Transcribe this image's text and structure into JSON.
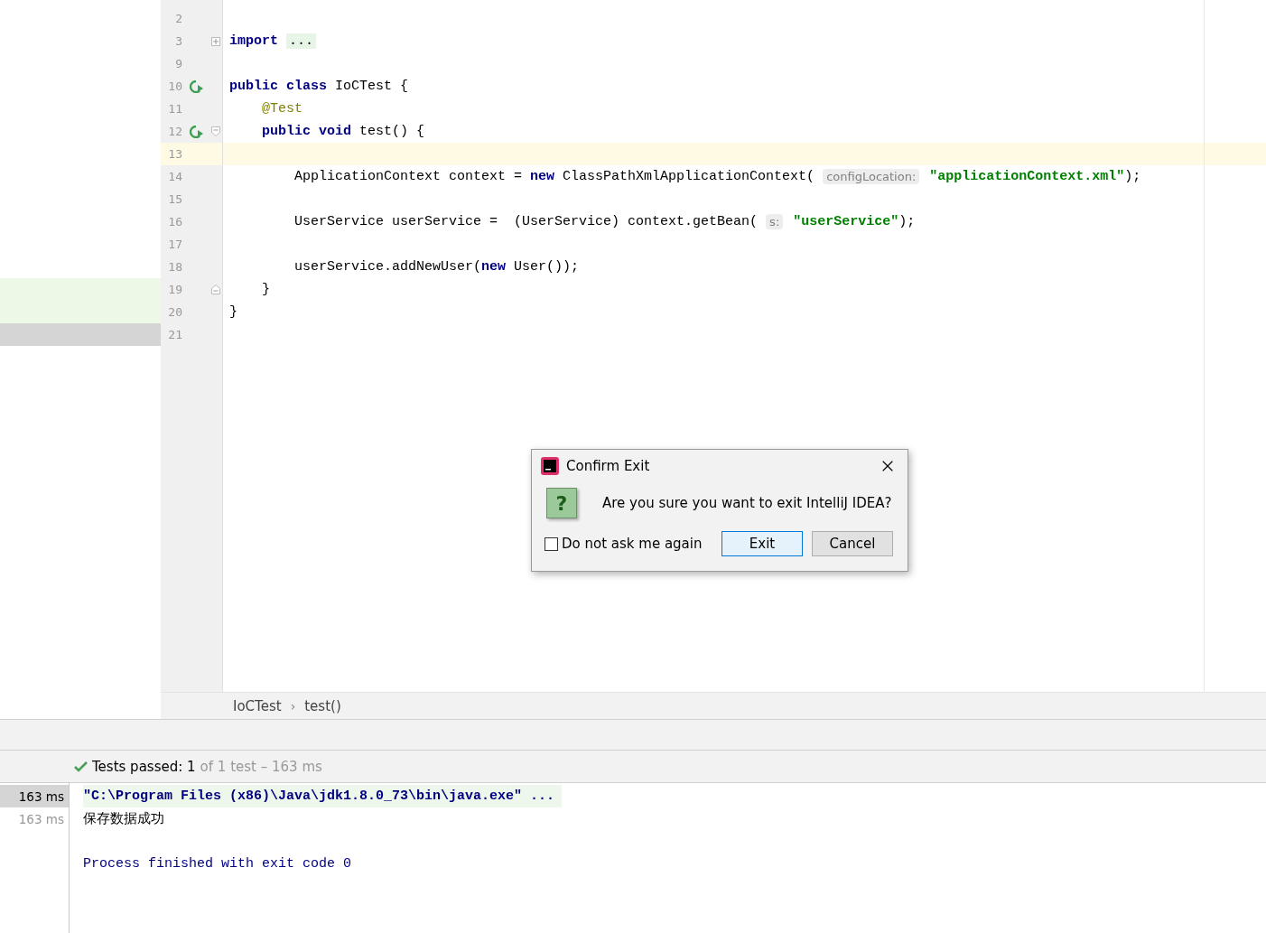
{
  "editor": {
    "lines": [
      {
        "number": "2"
      },
      {
        "number": "3",
        "fold_start": true,
        "collapsed": true,
        "tokens": [
          {
            "kind": "keyword",
            "text": "import "
          },
          {
            "kind": "folded",
            "text": "..."
          }
        ]
      },
      {
        "number": "9"
      },
      {
        "number": "10",
        "run": true,
        "tokens": [
          {
            "kind": "keyword",
            "text": "public class "
          },
          {
            "kind": "plain",
            "text": "IoCTest {"
          }
        ]
      },
      {
        "number": "11",
        "tokens": [
          {
            "kind": "annotation",
            "text": "    @Test"
          }
        ]
      },
      {
        "number": "12",
        "run": true,
        "fold_start": true,
        "collapsed": false,
        "tokens": [
          {
            "kind": "keyword",
            "text": "    public void "
          },
          {
            "kind": "plain",
            "text": "test() {"
          }
        ]
      },
      {
        "number": "13",
        "current": true
      },
      {
        "number": "14",
        "tokens": [
          {
            "kind": "plain",
            "text": "        ApplicationContext context = "
          },
          {
            "kind": "keyword",
            "text": "new"
          },
          {
            "kind": "plain",
            "text": " ClassPathXmlApplicationContext( "
          },
          {
            "kind": "hint",
            "text": "configLocation:"
          },
          {
            "kind": "string",
            "text": " \"applicationContext.xml\""
          },
          {
            "kind": "plain",
            "text": ");"
          }
        ]
      },
      {
        "number": "15"
      },
      {
        "number": "16",
        "tokens": [
          {
            "kind": "plain",
            "text": "        UserService userService =  (UserService) context.getBean( "
          },
          {
            "kind": "hint",
            "text": "s:"
          },
          {
            "kind": "string",
            "text": " \"userService\""
          },
          {
            "kind": "plain",
            "text": ");"
          }
        ]
      },
      {
        "number": "17"
      },
      {
        "number": "18",
        "tokens": [
          {
            "kind": "plain",
            "text": "        userService.addNewUser("
          },
          {
            "kind": "keyword",
            "text": "new"
          },
          {
            "kind": "plain",
            "text": " User());"
          }
        ]
      },
      {
        "number": "19",
        "fold_end": true,
        "tokens": [
          {
            "kind": "plain",
            "text": "    }"
          }
        ]
      },
      {
        "number": "20",
        "tokens": [
          {
            "kind": "plain",
            "text": "}"
          }
        ]
      },
      {
        "number": "21"
      }
    ]
  },
  "breadcrumbs": {
    "items": [
      "IoCTest",
      "test()"
    ],
    "separator": "›"
  },
  "test_status": {
    "label": "Tests passed:",
    "count": "1",
    "detail": "of 1 test – 163 ms"
  },
  "console": {
    "times": [
      {
        "text": "163 ms",
        "selected": true
      },
      {
        "text": "163 ms",
        "selected": false
      }
    ],
    "lines": [
      {
        "kind": "command",
        "text": "\"C:\\Program Files (x86)\\Java\\jdk1.8.0_73\\bin\\java.exe\" ..."
      },
      {
        "kind": "output",
        "text": "保存数据成功"
      },
      {
        "kind": "system",
        "text": "Process finished with exit code 0"
      }
    ]
  },
  "dialog": {
    "title": "Confirm Exit",
    "icon_glyph": "?",
    "message": "Are you sure you want to exit IntelliJ IDEA?",
    "checkbox": {
      "label": "Do not ask me again",
      "checked": false
    },
    "buttons": [
      {
        "label": "Exit",
        "default": true
      },
      {
        "label": "Cancel",
        "default": false
      }
    ]
  }
}
